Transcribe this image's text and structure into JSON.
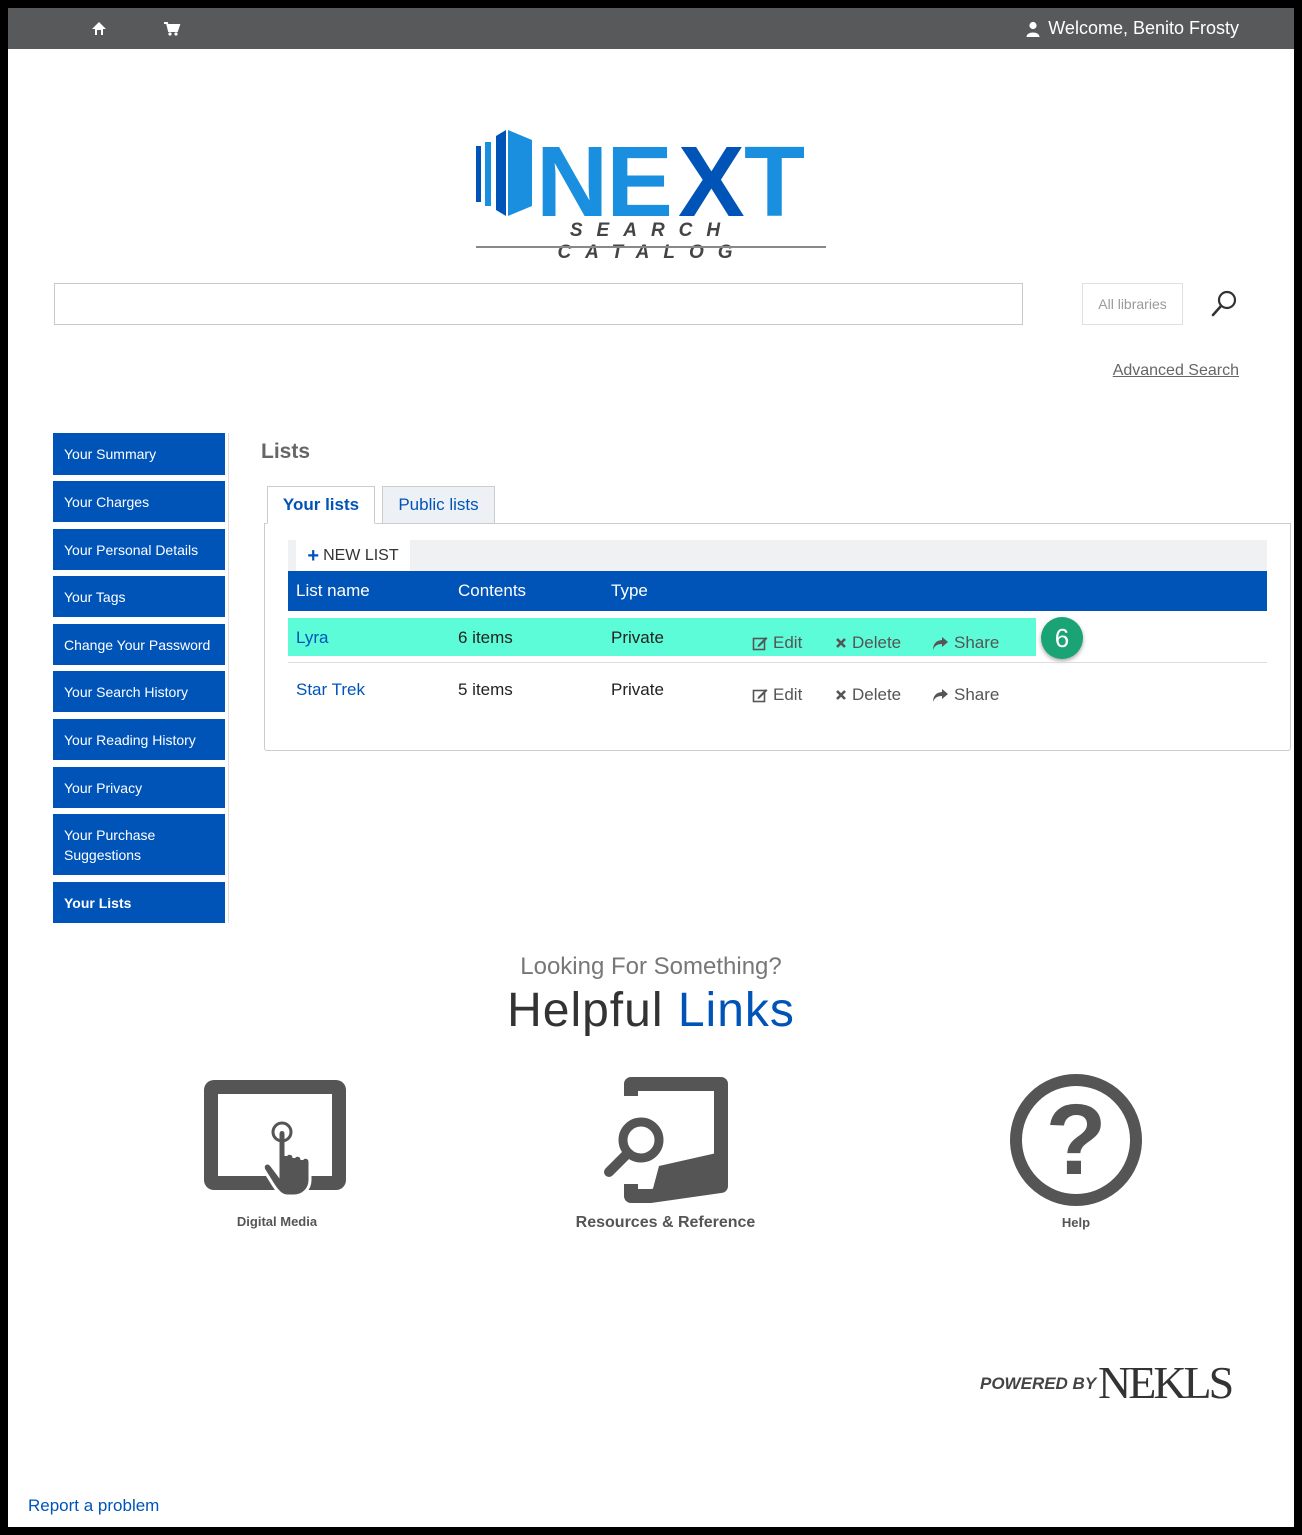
{
  "topbar": {
    "home_icon": "home-icon",
    "cart_icon": "cart-icon",
    "user_icon": "user-icon",
    "welcome": "Welcome, Benito Frosty"
  },
  "logo": {
    "main": "NEXT",
    "sub": "SEARCH CATALOG"
  },
  "search": {
    "value": "",
    "library_select": "All libraries",
    "advanced_link": "Advanced Search"
  },
  "sidebar": {
    "items": [
      {
        "label": "Your Summary"
      },
      {
        "label": "Your Charges"
      },
      {
        "label": "Your Personal Details"
      },
      {
        "label": "Your Tags"
      },
      {
        "label": "Change Your Password"
      },
      {
        "label": "Your Search History"
      },
      {
        "label": "Your Reading History"
      },
      {
        "label": "Your Privacy"
      },
      {
        "label": "Your Purchase Suggestions"
      },
      {
        "label": "Your Lists"
      }
    ]
  },
  "main": {
    "title": "Lists",
    "tabs": [
      {
        "label": "Your lists"
      },
      {
        "label": "Public lists"
      }
    ],
    "new_list": "NEW LIST",
    "columns": [
      "List name",
      "Contents",
      "Type"
    ],
    "rows": [
      {
        "name": "Lyra",
        "contents": "6 items",
        "type": "Private",
        "edit": "Edit",
        "delete": "Delete",
        "share": "Share"
      },
      {
        "name": "Star Trek",
        "contents": "5 items",
        "type": "Private",
        "edit": "Edit",
        "delete": "Delete",
        "share": "Share"
      }
    ],
    "badge": "6",
    "highlight_color": "#5dfcd8"
  },
  "helpful": {
    "looking": "Looking For Something?",
    "helpful_word": "Helpful",
    "links_word": "Links",
    "tiles": [
      {
        "label": "Digital Media",
        "icon": "tablet-touch-icon"
      },
      {
        "label": "Resources & Reference",
        "icon": "search-document-icon"
      },
      {
        "label": "Help",
        "icon": "question-circle-icon"
      }
    ]
  },
  "footer": {
    "powered_by": "POWERED BY",
    "brand": "NEKLS",
    "report": "Report a problem"
  },
  "colors": {
    "primary": "#0054b8",
    "topbar": "#58595b",
    "badge": "#1aa374"
  }
}
